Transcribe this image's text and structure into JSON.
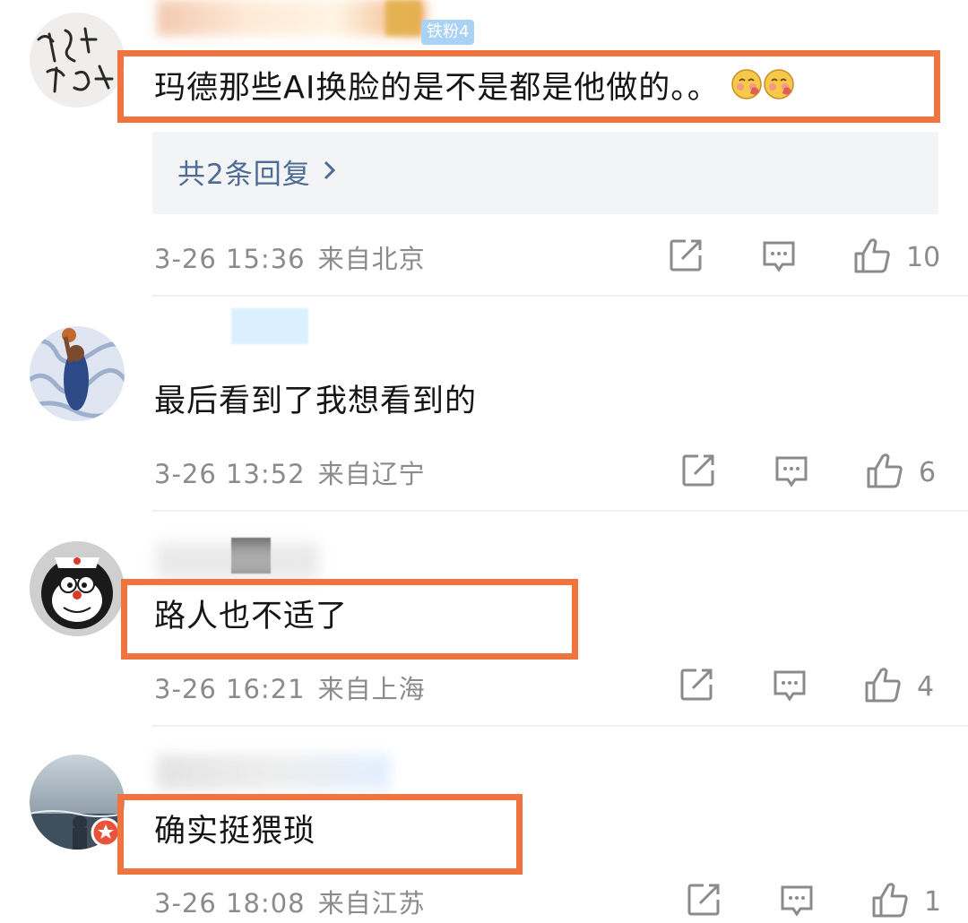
{
  "comments": [
    {
      "text": "玛德那些AI换脸的是不是都是他做的。。",
      "fan_badge": "铁粉4",
      "replies_label": "共2条回复",
      "time": "3-26 15:36",
      "location": "来自北京",
      "likes": "10"
    },
    {
      "text": "最后看到了我想看到的",
      "time": "3-26 13:52",
      "location": "来自辽宁",
      "likes": "6"
    },
    {
      "text": "路人也不适了",
      "time": "3-26 16:21",
      "location": "来自上海",
      "likes": "4"
    },
    {
      "text": "确实挺猥琐",
      "time": "3-26 18:08",
      "location": "来自江苏",
      "likes": "1"
    }
  ],
  "colors": {
    "highlight": "#f0743f",
    "link": "#4e6b95",
    "meta": "#8b8b8b",
    "reply_bg": "#f3f4f6"
  },
  "icons": [
    "share-icon",
    "comment-icon",
    "like-icon",
    "chevron-right-icon",
    "emoji-icon",
    "verified-badge-icon"
  ]
}
